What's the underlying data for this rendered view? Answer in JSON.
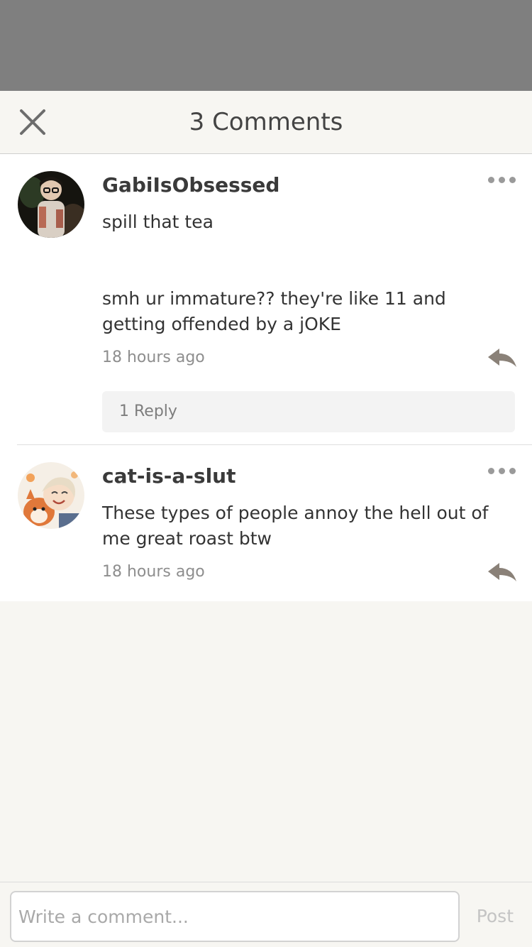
{
  "header": {
    "title": "3 Comments"
  },
  "comments": [
    {
      "username": "GabiIsObsessed",
      "text": "spill that tea\n\n\nsmh ur immature?? they're like 11 and getting offended by a jOKE",
      "time": "18 hours ago",
      "replies_label": "1 Reply"
    },
    {
      "username": "cat-is-a-slut",
      "text": "These types of people annoy the hell out of me great roast btw",
      "time": "18 hours ago"
    }
  ],
  "composer": {
    "placeholder": "Write a comment...",
    "post_label": "Post"
  },
  "icons": {
    "close": "close-icon",
    "more": "more-dots-icon",
    "reply": "reply-arrow-icon"
  },
  "colors": {
    "overlay": "#7f7f7f",
    "background": "#f7f6f2",
    "card": "#ffffff",
    "icon_gray": "#8a8178"
  }
}
